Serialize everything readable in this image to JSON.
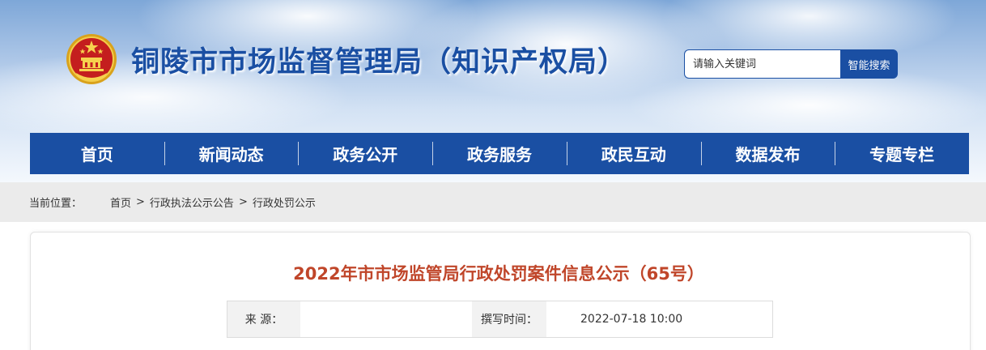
{
  "header": {
    "site_title": "铜陵市市场监督管理局（知识产权局）",
    "emblem_icon": "national-emblem-icon",
    "search": {
      "placeholder": "请输入关键词",
      "button_label": "智能搜索"
    }
  },
  "nav": {
    "items": [
      {
        "label": "首页"
      },
      {
        "label": "新闻动态"
      },
      {
        "label": "政务公开"
      },
      {
        "label": "政务服务"
      },
      {
        "label": "政民互动"
      },
      {
        "label": "数据发布"
      },
      {
        "label": "专题专栏"
      }
    ]
  },
  "breadcrumb": {
    "label": "当前位置：",
    "items": [
      "首页",
      "行政执法公示公告",
      "行政处罚公示"
    ],
    "separator": ">"
  },
  "article": {
    "title": "2022年市市场监管局行政处罚案件信息公示（65号）",
    "source_label": "来  源：",
    "source_value": "",
    "time_label": "撰写时间：",
    "time_value": "2022-07-18 10:00"
  },
  "colors": {
    "brand_blue": "#1a4fa3",
    "title_red": "#c0462a",
    "breadcrumb_bg": "#ebebeb"
  }
}
